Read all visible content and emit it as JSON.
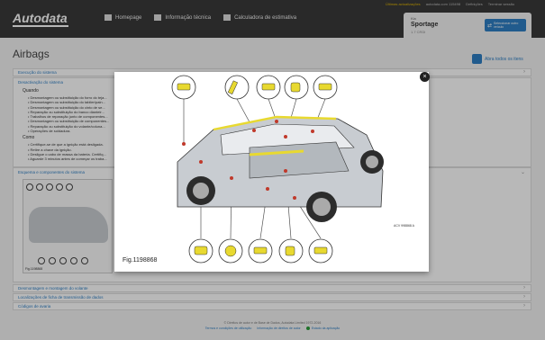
{
  "header": {
    "logo": "Autodata",
    "nav": [
      {
        "label": "Homepage",
        "icon": "home-icon"
      },
      {
        "label": "Informação técnica",
        "icon": "wrench-icon"
      },
      {
        "label": "Calculadora de estimativa",
        "icon": "calculator-icon"
      }
    ],
    "util": {
      "updates": "Últimas actualizações",
      "user": "autodata.com 115498",
      "settings": "Definições",
      "logout": "Terminar sessão"
    }
  },
  "vehicle": {
    "make": "Kia",
    "model": "Sportage",
    "engine": "1.7 CRDi",
    "select_label": "Seleccionar outro veículo"
  },
  "page": {
    "title": "Airbags",
    "open_all": "Abra todos os itens",
    "sections": {
      "s1": "Execução do sistema",
      "s2": "Desactivação do sistema",
      "s2_sub_when": "Quando",
      "s2_items_when": [
        "Desmontagem ou substituição do forro do teja...",
        "Desmontagem ou substituição do tablier/pain...",
        "Desmontagem ou substituição do cinto de se...",
        "Reparação ou substituição do banco dianteir...",
        "Trabalhos de reparação junto de componentes...",
        "Desmontagem ou substituição de componentes...",
        "Reparação ou substituição do volante/coluna...",
        "Operações de soldadura."
      ],
      "s2_sub_how": "Como",
      "s2_items_how": [
        "Certifique-se de que a ignição está desligada.",
        "Retire a chave da ignição.",
        "Desligue o cabo de massa da bateria. Certifiq...",
        "Aguarde 3 minutos antes de começar os traba..."
      ],
      "s3": "Esquema e componentes do sistema",
      "s3_fig": "Fig.1198868",
      "s4": "Desmontagem e montagem do volante",
      "s5": "Localizações de ficha de transmissão de dados",
      "s6": "Códigos de avaria"
    }
  },
  "footer": {
    "copyright": "© Direitos de autor e de Base de Dados, Autodata Limited 1972-2016",
    "links": [
      "Termos e condições de utilização",
      "Informação de direitos de autor",
      "Estado da aplicação"
    ]
  },
  "modal": {
    "caption": "Fig.1198868",
    "drawing_code": "ACV 998868 A",
    "close_label": "×"
  },
  "colors": {
    "accent": "#2f7fc4",
    "topbar": "#3a3a3a",
    "airbag": "#e8d930",
    "status_ok": "#2a9d3a"
  }
}
